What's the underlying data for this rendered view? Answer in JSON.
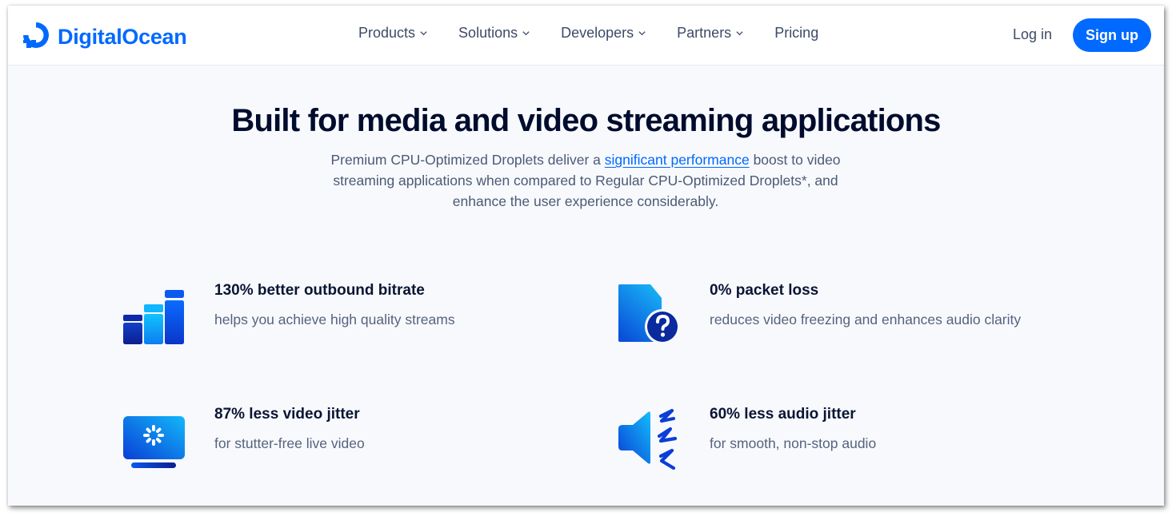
{
  "header": {
    "brand": "DigitalOcean",
    "logo_icon": "digitalocean-logo-icon",
    "nav": [
      {
        "label": "Products",
        "has_dropdown": true
      },
      {
        "label": "Solutions",
        "has_dropdown": true
      },
      {
        "label": "Developers",
        "has_dropdown": true
      },
      {
        "label": "Partners",
        "has_dropdown": true
      },
      {
        "label": "Pricing",
        "has_dropdown": false
      }
    ],
    "login_label": "Log in",
    "signup_label": "Sign up"
  },
  "hero": {
    "title": "Built for media and video streaming applications",
    "desc_before": "Premium CPU-Optimized Droplets deliver a ",
    "desc_link": "significant performance",
    "desc_after": " boost to video streaming applications when compared to Regular CPU-Optimized Droplets*, and enhance the user experience considerably."
  },
  "features": [
    {
      "icon": "bar-chart-icon",
      "title": "130% better outbound bitrate",
      "desc": "helps you achieve high quality streams"
    },
    {
      "icon": "file-question-icon",
      "title": "0% packet loss",
      "desc": "reduces video freezing and enhances audio clarity"
    },
    {
      "icon": "monitor-loading-icon",
      "title": "87% less video jitter",
      "desc": "for stutter-free live video"
    },
    {
      "icon": "speaker-jitter-icon",
      "title": "60% less audio jitter",
      "desc": "for smooth, non-stop audio"
    }
  ],
  "colors": {
    "brand": "#0069ff",
    "heading": "#000c2d",
    "body_text": "#4c5a75",
    "page_bg": "#f7f9fd"
  }
}
